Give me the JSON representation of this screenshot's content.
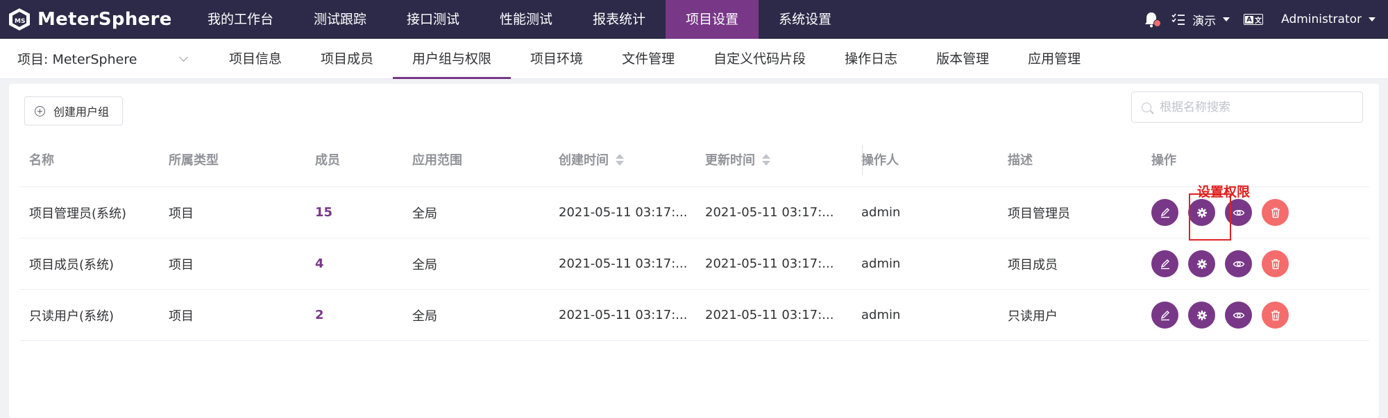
{
  "brand": {
    "name": "MeterSphere"
  },
  "nav": {
    "items": [
      {
        "label": "我的工作台"
      },
      {
        "label": "测试跟踪"
      },
      {
        "label": "接口测试"
      },
      {
        "label": "性能测试"
      },
      {
        "label": "报表统计"
      },
      {
        "label": "项目设置",
        "active": true
      },
      {
        "label": "系统设置"
      }
    ]
  },
  "topright": {
    "workspace": "演示",
    "user": "Administrator"
  },
  "project": {
    "label": "项目: MeterSphere"
  },
  "subnav": {
    "items": [
      {
        "label": "项目信息"
      },
      {
        "label": "项目成员"
      },
      {
        "label": "用户组与权限",
        "active": true
      },
      {
        "label": "项目环境"
      },
      {
        "label": "文件管理"
      },
      {
        "label": "自定义代码片段"
      },
      {
        "label": "操作日志"
      },
      {
        "label": "版本管理"
      },
      {
        "label": "应用管理"
      }
    ]
  },
  "toolbar": {
    "create_label": "创建用户组",
    "search_placeholder": "根据名称搜索"
  },
  "table": {
    "headers": {
      "name": "名称",
      "type": "所属类型",
      "members": "成员",
      "scope": "应用范围",
      "created": "创建时间",
      "updated": "更新时间",
      "operator": "操作人",
      "desc": "描述",
      "actions": "操作"
    },
    "rows": [
      {
        "name": "项目管理员(系统)",
        "type": "项目",
        "members": "15",
        "scope": "全局",
        "created": "2021-05-11 03:17:...",
        "updated": "2021-05-11 03:17:...",
        "operator": "admin",
        "desc": "项目管理员"
      },
      {
        "name": "项目成员(系统)",
        "type": "项目",
        "members": "4",
        "scope": "全局",
        "created": "2021-05-11 03:17:...",
        "updated": "2021-05-11 03:17:...",
        "operator": "admin",
        "desc": "项目成员"
      },
      {
        "name": "只读用户(系统)",
        "type": "项目",
        "members": "2",
        "scope": "全局",
        "created": "2021-05-11 03:17:...",
        "updated": "2021-05-11 03:17:...",
        "operator": "admin",
        "desc": "只读用户"
      }
    ]
  },
  "annotation": {
    "label": "设置权限"
  },
  "colors": {
    "nav_bg": "#2c2a48",
    "accent": "#783887",
    "danger": "#f56c6c",
    "annotation": "#e02020"
  },
  "icons": [
    "bell-icon",
    "task-list-icon",
    "language-icon",
    "plus-circle-icon",
    "search-icon",
    "edit-icon",
    "gear-icon",
    "eye-icon",
    "trash-icon",
    "sort-caret-icon",
    "chevron-down-icon"
  ]
}
